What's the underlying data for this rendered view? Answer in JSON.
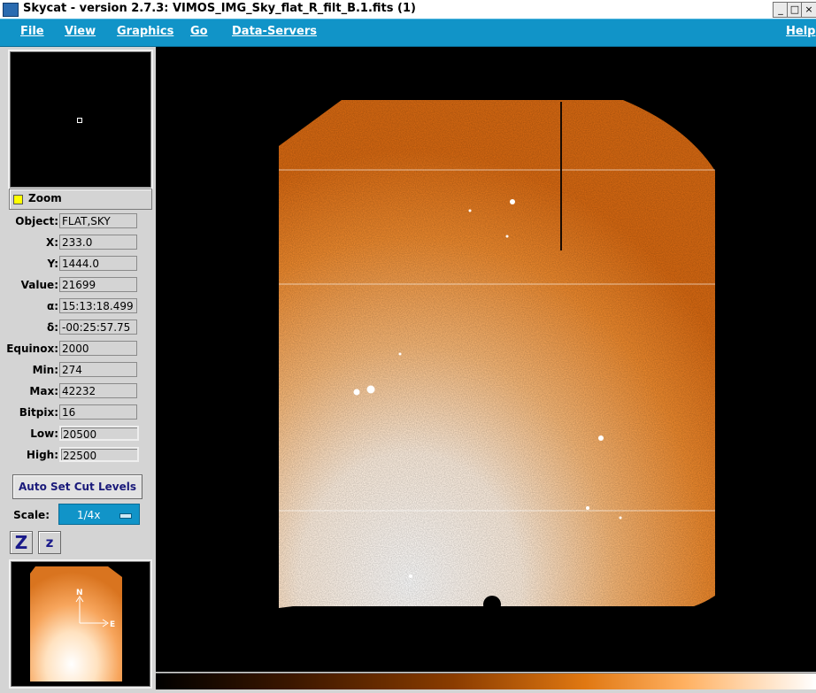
{
  "window": {
    "title": "Skycat - version 2.7.3: VIMOS_IMG_Sky_flat_R_filt_B.1.fits (1)",
    "buttons": [
      "_",
      "□",
      "×"
    ]
  },
  "menubar": {
    "file": "File",
    "view": "View",
    "graphics": "Graphics",
    "go": "Go",
    "data_servers": "Data-Servers",
    "help": "Help"
  },
  "zoom_toggle": {
    "label": "Zoom",
    "checked": true,
    "color": "#ffff00"
  },
  "info": {
    "object": {
      "label": "Object:",
      "value": "FLAT,SKY"
    },
    "x": {
      "label": "X:",
      "value": "233.0"
    },
    "y": {
      "label": "Y:",
      "value": "1444.0"
    },
    "value": {
      "label": "Value:",
      "value": "21699"
    },
    "alpha": {
      "label": "α:",
      "value": "15:13:18.499"
    },
    "delta": {
      "label": "δ:",
      "value": "-00:25:57.75"
    },
    "equinox": {
      "label": "Equinox:",
      "value": "2000"
    },
    "min": {
      "label": "Min:",
      "value": "274"
    },
    "max": {
      "label": "Max:",
      "value": "42232"
    },
    "bitpix": {
      "label": "Bitpix:",
      "value": "16"
    },
    "low": {
      "label": "Low:",
      "value": "20500"
    },
    "high": {
      "label": "High:",
      "value": "22500"
    }
  },
  "controls": {
    "auto_cut": "Auto Set Cut Levels",
    "scale_label": "Scale:",
    "scale_value": "1/4x",
    "zoom_in": "Z",
    "zoom_out": "z"
  },
  "compass": {
    "north": "N",
    "east": "E"
  },
  "image": {
    "colormap": "orange-heat",
    "accent": "#1194c8"
  }
}
